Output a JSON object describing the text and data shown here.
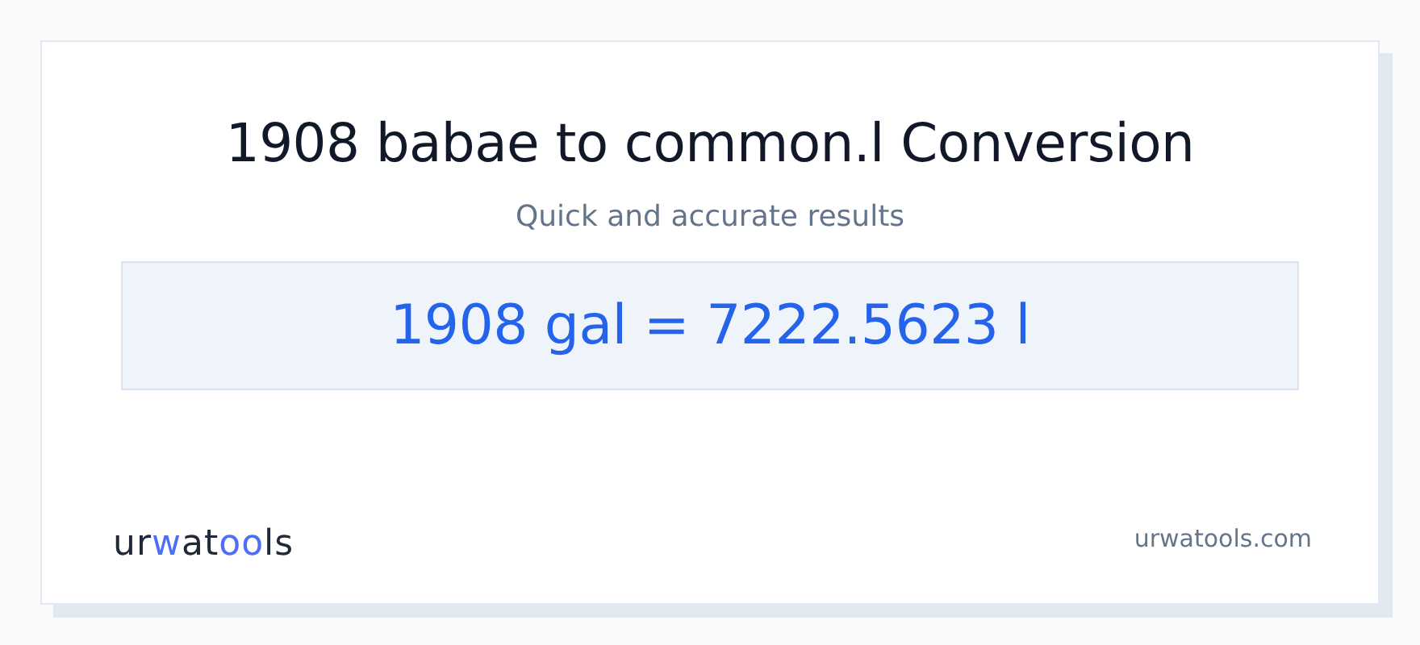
{
  "title": "1908 babae to common.l Conversion",
  "subtitle": "Quick and accurate results",
  "result": "1908 gal = 7222.5623 l",
  "logo": [
    {
      "text": "ur",
      "accent": false
    },
    {
      "text": "w",
      "accent": true
    },
    {
      "text": "at",
      "accent": false
    },
    {
      "text": "oo",
      "accent": true
    },
    {
      "text": "ls",
      "accent": false
    }
  ],
  "site": "urwatools.com"
}
